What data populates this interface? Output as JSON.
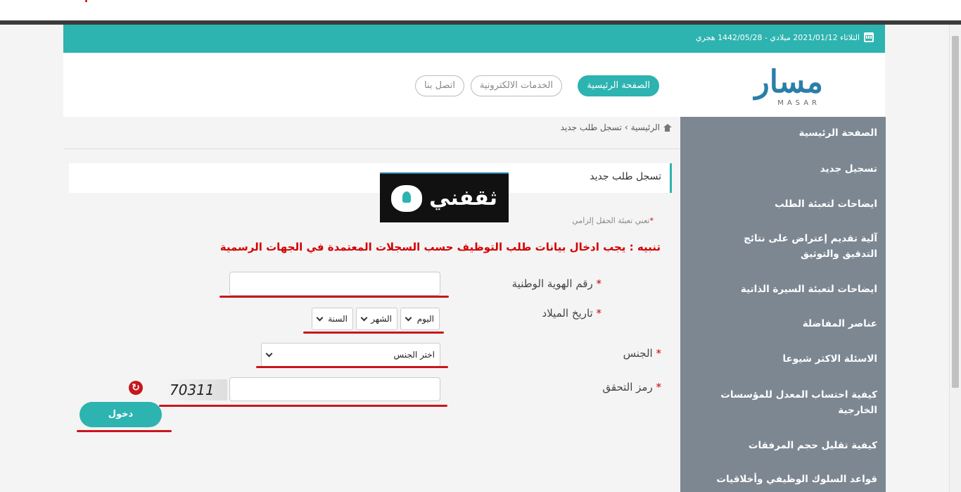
{
  "topbar": {
    "date_text": "الثلاثاء 2021/01/12 ميلادي - 1442/05/28 هجري"
  },
  "logo": {
    "arabic": "مسار",
    "english": "MASAR"
  },
  "nav": {
    "home": "الصفحة الرئيسية",
    "eservices": "الخدمات الالكترونية",
    "contact": "اتصل بنا"
  },
  "sidebar": {
    "items": [
      {
        "label": "الصفحة الرئيسية"
      },
      {
        "label": "تسجيل جديد"
      },
      {
        "label": "ايضاحات لتعبئة الطلب"
      },
      {
        "label": "آلية تقديم إعتراض على نتائج التدقيق والتوثيق"
      },
      {
        "label": "ايضاحات لتعبئة السيرة الذاتية"
      },
      {
        "label": "عناصر المفاضلة"
      },
      {
        "label": "الاسئلة الاكثر شيوعا"
      },
      {
        "label": "كيفية احتساب المعدل للمؤسسات الخارجية"
      },
      {
        "label": "كيفية تقليل حجم المرفقات"
      },
      {
        "label": "قواعد السلوك الوظيفي وأخلاقيات"
      }
    ]
  },
  "breadcrumb": {
    "home": "الرئيسية",
    "separator": "›",
    "current": "تسجل طلب جديد"
  },
  "panel": {
    "title": "تسجل طلب جديد"
  },
  "watermark": {
    "text": "ثقفني"
  },
  "form": {
    "required_note": "تعني تعبئة الحقل إلزامي",
    "warning": "تنبيه : يجب ادخال بيانات طلب التوظيف حسب السجلات المعتمدة في الجهات الرسمية",
    "national_id_label": "رقم الهوية الوطنية",
    "birthdate_label": "تاريخ الميلاد",
    "day": "اليوم",
    "month": "الشهر",
    "year": "السنة",
    "gender_label": "الجنس",
    "gender_value": "اختر الجنس",
    "captcha_label": "رمز التحقق",
    "captcha_code": "70311",
    "required_mark": "*",
    "login": "دخول"
  }
}
